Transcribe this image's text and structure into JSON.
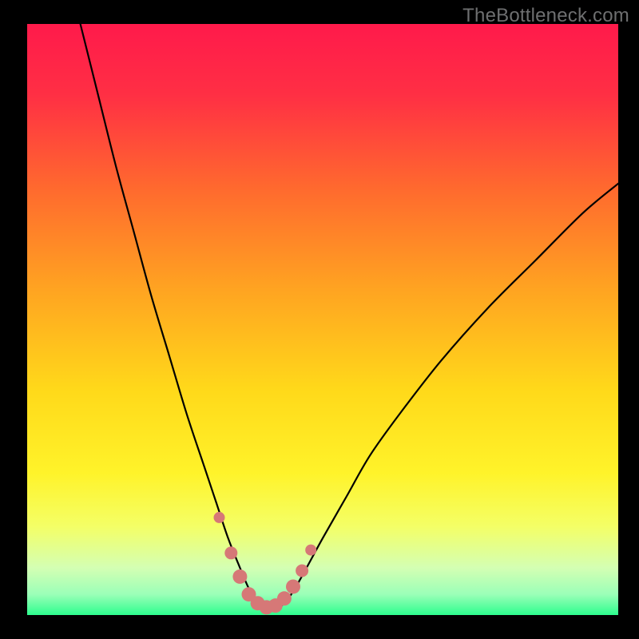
{
  "watermark": "TheBottleneck.com",
  "gradient_stops": [
    {
      "offset": 0.0,
      "color": "#ff1a4b"
    },
    {
      "offset": 0.12,
      "color": "#ff2f44"
    },
    {
      "offset": 0.28,
      "color": "#ff6a2e"
    },
    {
      "offset": 0.45,
      "color": "#ffa421"
    },
    {
      "offset": 0.62,
      "color": "#ffd91a"
    },
    {
      "offset": 0.76,
      "color": "#fff32a"
    },
    {
      "offset": 0.85,
      "color": "#f4ff66"
    },
    {
      "offset": 0.92,
      "color": "#d4ffb3"
    },
    {
      "offset": 0.965,
      "color": "#9bffb8"
    },
    {
      "offset": 1.0,
      "color": "#2dfd8e"
    }
  ],
  "chart_data": {
    "type": "line",
    "title": "",
    "xlabel": "",
    "ylabel": "",
    "xlim": [
      0,
      100
    ],
    "ylim": [
      0,
      100
    ],
    "series": [
      {
        "name": "curve",
        "x": [
          9,
          12,
          15,
          18,
          21,
          24,
          27,
          30,
          32,
          34,
          36,
          37.5,
          39,
          40.5,
          42,
          43.5,
          45,
          47,
          50,
          54,
          58,
          63,
          70,
          78,
          86,
          94,
          100
        ],
        "values": [
          100,
          88,
          76,
          65,
          54,
          44,
          34,
          25,
          19,
          13,
          8,
          4.5,
          2,
          1,
          1,
          2,
          4,
          7.5,
          13,
          20,
          27,
          34,
          43,
          52,
          60,
          68,
          73
        ]
      }
    ],
    "markers": {
      "name": "dots",
      "color": "#d67877",
      "x": [
        32.5,
        34.5,
        36.0,
        37.5,
        39.0,
        40.5,
        42.0,
        43.5,
        45.0,
        46.5,
        48.0
      ],
      "values": [
        16.5,
        10.5,
        6.5,
        3.5,
        2.0,
        1.3,
        1.6,
        2.8,
        4.8,
        7.5,
        11.0
      ],
      "r": [
        7,
        8,
        9,
        9,
        9,
        9,
        9,
        9,
        9,
        8,
        7
      ]
    }
  }
}
